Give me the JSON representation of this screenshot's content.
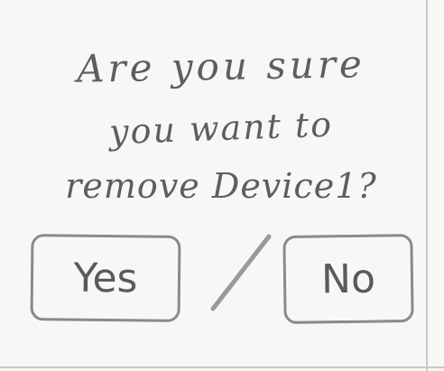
{
  "dialog": {
    "question_lines": [
      "Are you sure",
      "you want to",
      "remove Device1?"
    ],
    "buttons": {
      "yes_label": "Yes",
      "separator": "/",
      "no_label": "No"
    }
  }
}
